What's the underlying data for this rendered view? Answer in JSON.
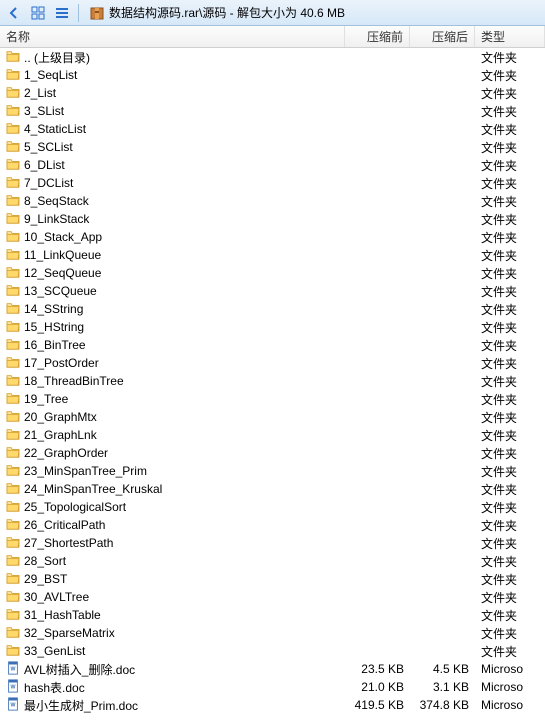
{
  "toolbar": {
    "path": "数据结构源码.rar\\源码 - 解包大小为 40.6 MB"
  },
  "columns": {
    "name": "名称",
    "before": "压缩前",
    "after": "压缩后",
    "type": "类型"
  },
  "rows": [
    {
      "icon": "folder",
      "name": ".. (上级目录)",
      "before": "",
      "after": "",
      "type": "文件夹"
    },
    {
      "icon": "folder",
      "name": "1_SeqList",
      "before": "",
      "after": "",
      "type": "文件夹"
    },
    {
      "icon": "folder",
      "name": "2_List",
      "before": "",
      "after": "",
      "type": "文件夹"
    },
    {
      "icon": "folder",
      "name": "3_SList",
      "before": "",
      "after": "",
      "type": "文件夹"
    },
    {
      "icon": "folder",
      "name": "4_StaticList",
      "before": "",
      "after": "",
      "type": "文件夹"
    },
    {
      "icon": "folder",
      "name": "5_SCList",
      "before": "",
      "after": "",
      "type": "文件夹"
    },
    {
      "icon": "folder",
      "name": "6_DList",
      "before": "",
      "after": "",
      "type": "文件夹"
    },
    {
      "icon": "folder",
      "name": "7_DCList",
      "before": "",
      "after": "",
      "type": "文件夹"
    },
    {
      "icon": "folder",
      "name": "8_SeqStack",
      "before": "",
      "after": "",
      "type": "文件夹"
    },
    {
      "icon": "folder",
      "name": "9_LinkStack",
      "before": "",
      "after": "",
      "type": "文件夹"
    },
    {
      "icon": "folder",
      "name": "10_Stack_App",
      "before": "",
      "after": "",
      "type": "文件夹"
    },
    {
      "icon": "folder",
      "name": "11_LinkQueue",
      "before": "",
      "after": "",
      "type": "文件夹"
    },
    {
      "icon": "folder",
      "name": "12_SeqQueue",
      "before": "",
      "after": "",
      "type": "文件夹"
    },
    {
      "icon": "folder",
      "name": "13_SCQueue",
      "before": "",
      "after": "",
      "type": "文件夹"
    },
    {
      "icon": "folder",
      "name": "14_SString",
      "before": "",
      "after": "",
      "type": "文件夹"
    },
    {
      "icon": "folder",
      "name": "15_HString",
      "before": "",
      "after": "",
      "type": "文件夹"
    },
    {
      "icon": "folder",
      "name": "16_BinTree",
      "before": "",
      "after": "",
      "type": "文件夹"
    },
    {
      "icon": "folder",
      "name": "17_PostOrder",
      "before": "",
      "after": "",
      "type": "文件夹"
    },
    {
      "icon": "folder",
      "name": "18_ThreadBinTree",
      "before": "",
      "after": "",
      "type": "文件夹"
    },
    {
      "icon": "folder",
      "name": "19_Tree",
      "before": "",
      "after": "",
      "type": "文件夹"
    },
    {
      "icon": "folder",
      "name": "20_GraphMtx",
      "before": "",
      "after": "",
      "type": "文件夹"
    },
    {
      "icon": "folder",
      "name": "21_GraphLnk",
      "before": "",
      "after": "",
      "type": "文件夹"
    },
    {
      "icon": "folder",
      "name": "22_GraphOrder",
      "before": "",
      "after": "",
      "type": "文件夹"
    },
    {
      "icon": "folder",
      "name": "23_MinSpanTree_Prim",
      "before": "",
      "after": "",
      "type": "文件夹"
    },
    {
      "icon": "folder",
      "name": "24_MinSpanTree_Kruskal",
      "before": "",
      "after": "",
      "type": "文件夹"
    },
    {
      "icon": "folder",
      "name": "25_TopologicalSort",
      "before": "",
      "after": "",
      "type": "文件夹"
    },
    {
      "icon": "folder",
      "name": "26_CriticalPath",
      "before": "",
      "after": "",
      "type": "文件夹"
    },
    {
      "icon": "folder",
      "name": "27_ShortestPath",
      "before": "",
      "after": "",
      "type": "文件夹"
    },
    {
      "icon": "folder",
      "name": "28_Sort",
      "before": "",
      "after": "",
      "type": "文件夹"
    },
    {
      "icon": "folder",
      "name": "29_BST",
      "before": "",
      "after": "",
      "type": "文件夹"
    },
    {
      "icon": "folder",
      "name": "30_AVLTree",
      "before": "",
      "after": "",
      "type": "文件夹"
    },
    {
      "icon": "folder",
      "name": "31_HashTable",
      "before": "",
      "after": "",
      "type": "文件夹"
    },
    {
      "icon": "folder",
      "name": "32_SparseMatrix",
      "before": "",
      "after": "",
      "type": "文件夹"
    },
    {
      "icon": "folder",
      "name": "33_GenList",
      "before": "",
      "after": "",
      "type": "文件夹"
    },
    {
      "icon": "doc",
      "name": "AVL树插入_删除.doc",
      "before": "23.5 KB",
      "after": "4.5 KB",
      "type": "Microso"
    },
    {
      "icon": "doc",
      "name": "hash表.doc",
      "before": "21.0 KB",
      "after": "3.1 KB",
      "type": "Microso"
    },
    {
      "icon": "doc",
      "name": "最小生成树_Prim.doc",
      "before": "419.5 KB",
      "after": "374.8 KB",
      "type": "Microso"
    }
  ]
}
